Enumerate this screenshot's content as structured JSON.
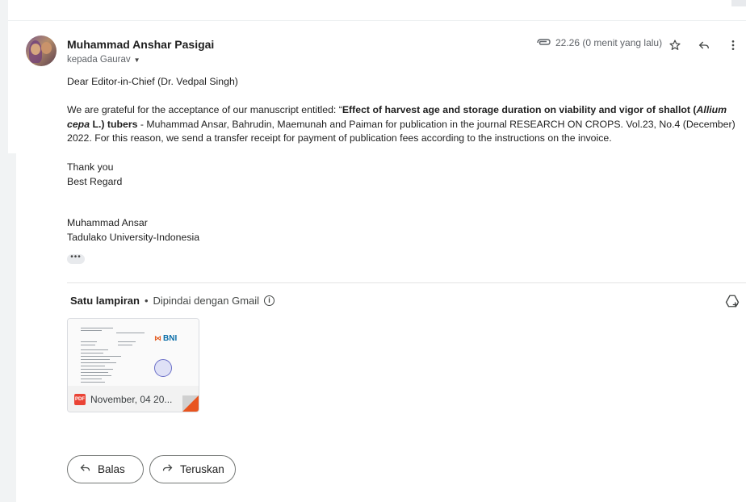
{
  "email": {
    "sender": "Muhammad Anshar Pasigai",
    "recipient": "kepada Gaurav",
    "time": "22.26 (0 menit yang lalu)",
    "greeting": "Dear Editor-in-Chief (Dr. Vedpal Singh)",
    "para_before": "We are grateful for the acceptance of our manuscript entitled: “",
    "para_bold1": "Effect of harvest age and storage duration on viability and vigor of shallot (",
    "para_italic": "Allium cepa",
    "para_bold2": " L.) tubers",
    "para_after": " - Muhammad Ansar, Bahrudin, Maemunah and Paiman for publication in the journal RESEARCH ON CROPS. Vol.23, No.4 (December) 2022. For this reason, we send a transfer receipt for payment of publication fees according to the instructions on the invoice.",
    "thanks": "Thank you",
    "regards": "Best Regard",
    "sig_name": "Muhammad Ansar",
    "sig_org": "Tadulako University-Indonesia",
    "ellipsis": "•••"
  },
  "attachments": {
    "title": "Satu lampiran",
    "separator": "•",
    "scanned": "Dipindai dengan Gmail",
    "file_name": "November, 04 20...",
    "file_type": "PDF",
    "thumb_brand": "BNI"
  },
  "actions": {
    "reply_label": "Balas",
    "forward_label": "Teruskan"
  },
  "icons": {
    "attachment": "paperclip-icon",
    "star": "star-icon",
    "reply": "reply-icon",
    "more": "more-vert-icon",
    "drive": "add-to-drive-icon",
    "info": "info-icon"
  },
  "colors": {
    "pdf": "#ea4335",
    "bni": "#0b6ea8",
    "fold": "#e8541f"
  }
}
